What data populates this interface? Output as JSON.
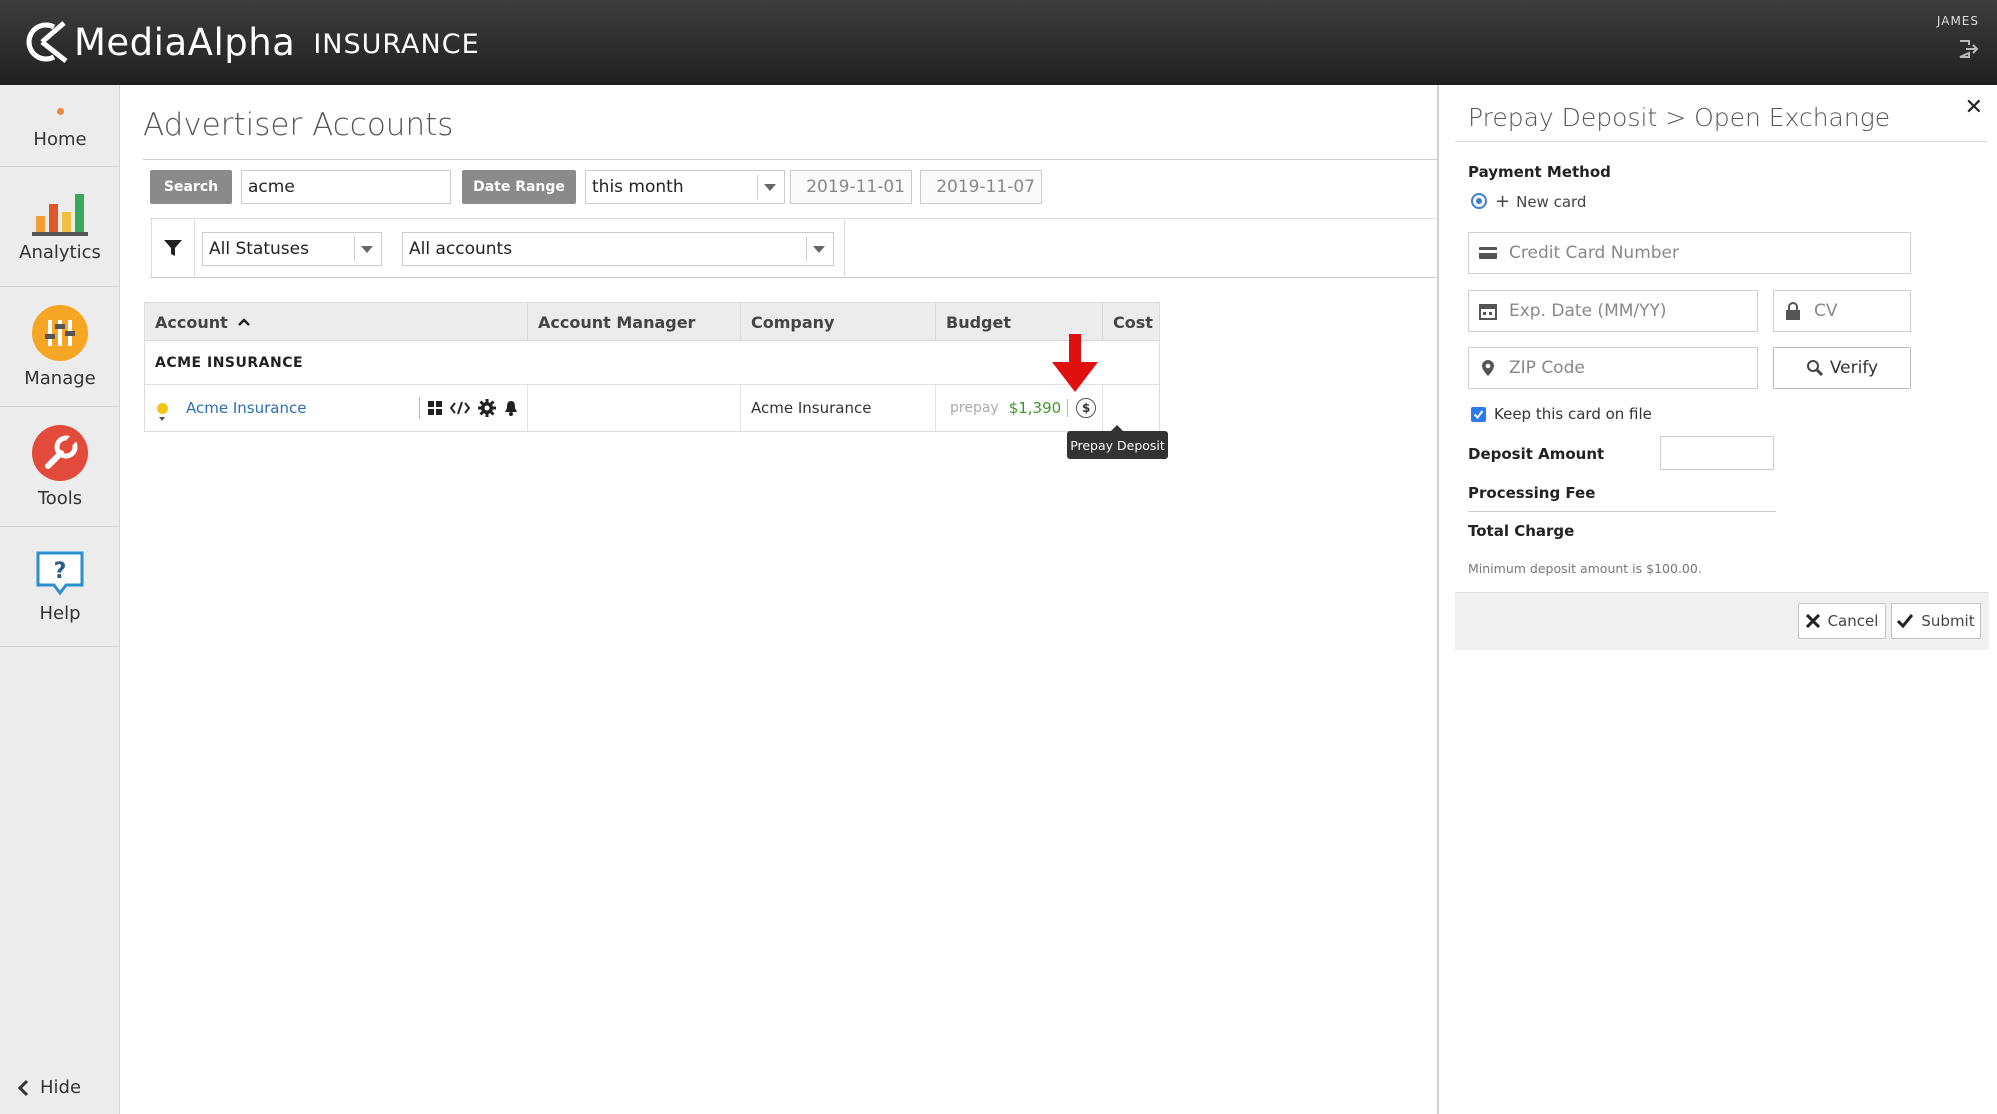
{
  "header": {
    "brand": "MediaAlpha",
    "product": "INSURANCE",
    "user": "JAMES",
    "logout_icon": "logout-icon"
  },
  "sidebar": {
    "items": [
      {
        "label": "Home",
        "icon": "home-icon"
      },
      {
        "label": "Analytics",
        "icon": "bar-chart-icon"
      },
      {
        "label": "Manage",
        "icon": "sliders-icon"
      },
      {
        "label": "Tools",
        "icon": "wrench-icon"
      },
      {
        "label": "Help",
        "icon": "help-icon"
      }
    ],
    "hide_label": "Hide"
  },
  "main": {
    "title": "Advertiser Accounts",
    "search_button": "Search",
    "search_value": "acme",
    "date_range_button": "Date Range",
    "date_range_value": "this month",
    "date_from": "2019-11-01",
    "date_to": "2019-11-07",
    "status_filter": "All Statuses",
    "accounts_filter": "All accounts"
  },
  "table": {
    "columns": [
      "Account",
      "Account Manager",
      "Company",
      "Budget",
      "Cost"
    ],
    "sort_column": "Account",
    "group": "ACME INSURANCE",
    "rows": [
      {
        "account": "Acme Insurance",
        "account_manager": "",
        "company": "Acme Insurance",
        "budget_type": "prepay",
        "budget_amount": "$1,390",
        "cost": ""
      }
    ],
    "tooltip": "Prepay Deposit"
  },
  "panel": {
    "title": "Prepay Deposit > Open Exchange",
    "payment_method_label": "Payment Method",
    "new_card_label": "New card",
    "card_number_placeholder": "Credit Card Number",
    "exp_placeholder": "Exp. Date (MM/YY)",
    "cv_placeholder": "CV",
    "zip_placeholder": "ZIP Code",
    "verify_label": "Verify",
    "keep_card_label": "Keep this card on file",
    "deposit_amount_label": "Deposit Amount",
    "processing_fee_label": "Processing Fee",
    "total_charge_label": "Total Charge",
    "minimum_note": "Minimum deposit amount is $100.00.",
    "cancel_label": "Cancel",
    "submit_label": "Submit"
  },
  "colors": {
    "header_bg": "#2b2b2b",
    "link": "#2a6fb7",
    "budget_green": "#3a9a2a",
    "accent_blue": "#2c7be5",
    "arrow_red": "#e01010"
  }
}
